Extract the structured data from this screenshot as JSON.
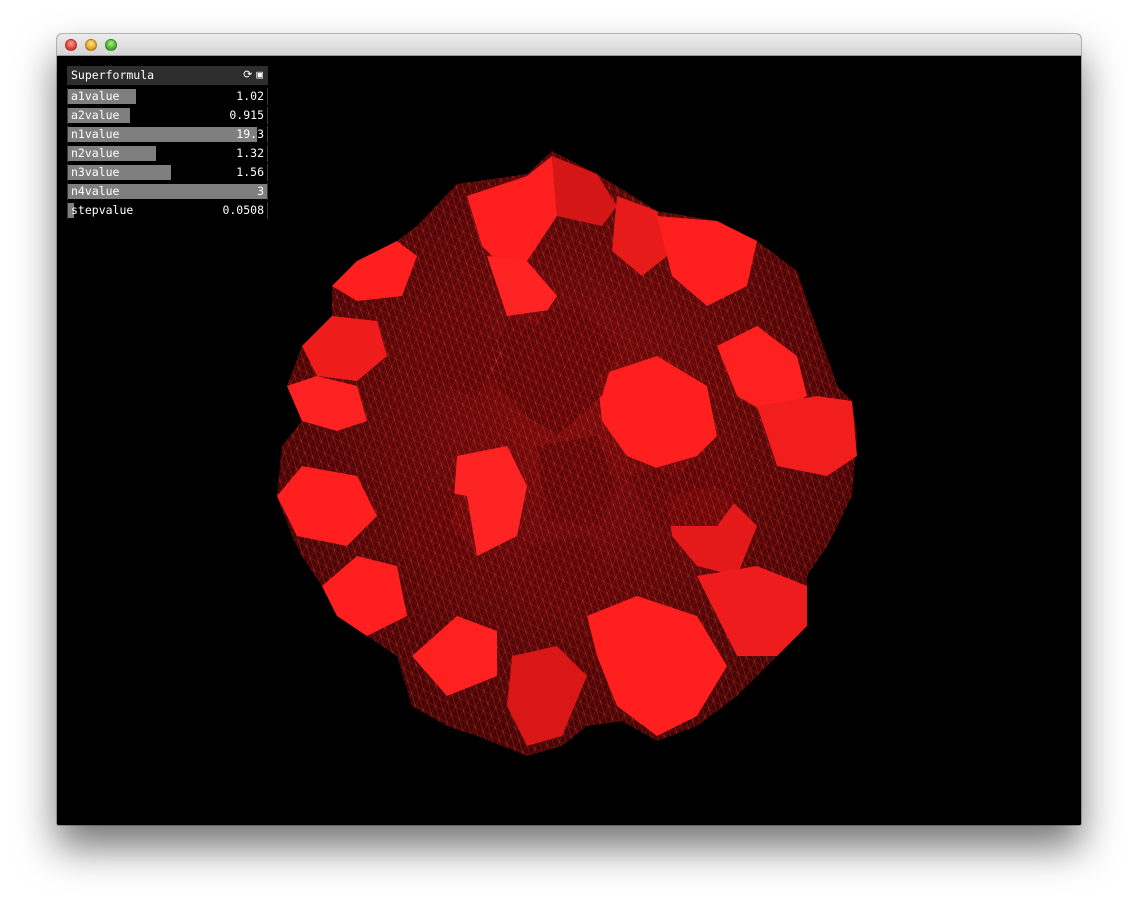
{
  "window": {
    "title": ""
  },
  "panel": {
    "title": "Superformula",
    "icons": [
      "refresh-icon",
      "save-icon"
    ],
    "sliders": [
      {
        "label": "a1value",
        "value": "1.02",
        "fill": 0.34
      },
      {
        "label": "a2value",
        "value": "0.915",
        "fill": 0.31
      },
      {
        "label": "n1value",
        "value": "19.3",
        "fill": 0.95
      },
      {
        "label": "n2value",
        "value": "1.32",
        "fill": 0.44
      },
      {
        "label": "n3value",
        "value": "1.56",
        "fill": 0.52
      },
      {
        "label": "n4value",
        "value": "3",
        "fill": 1.0
      },
      {
        "label": "stepvalue",
        "value": "0.0508",
        "fill": 0.03
      }
    ]
  },
  "colors": {
    "mesh": "#ff1f1f",
    "mesh_dark": "#5a0808",
    "background": "#000000",
    "slider_fill": "#7f7f7f"
  }
}
